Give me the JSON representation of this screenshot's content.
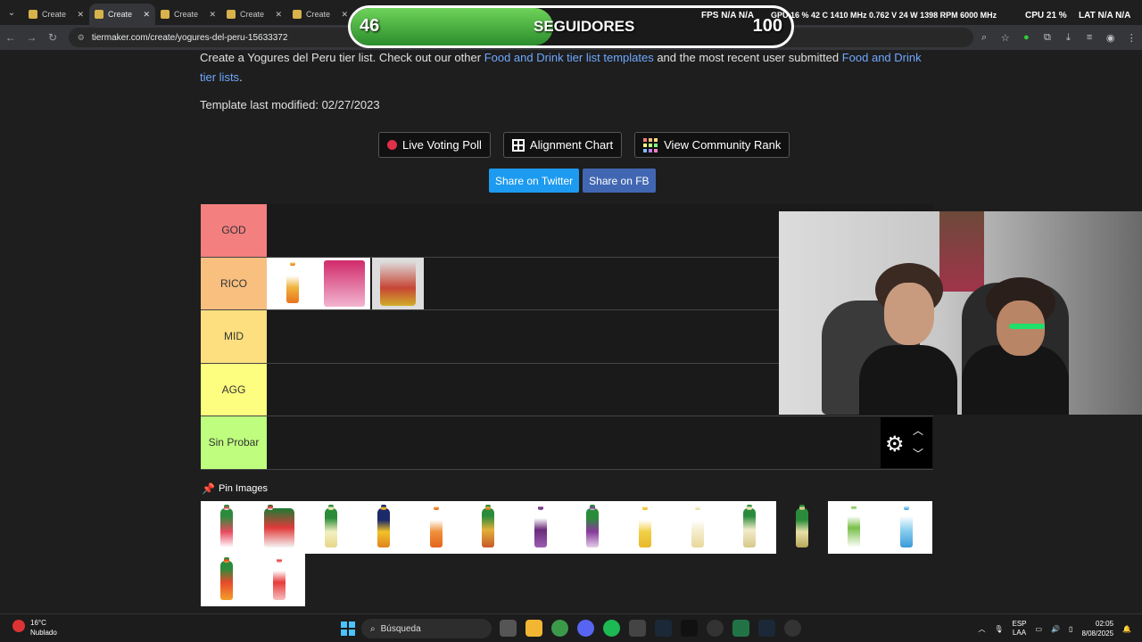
{
  "browser": {
    "tabs": [
      {
        "label": "Create",
        "active": false
      },
      {
        "label": "Create",
        "active": true
      },
      {
        "label": "Create",
        "active": false
      },
      {
        "label": "Create",
        "active": false
      },
      {
        "label": "Create",
        "active": false
      }
    ],
    "url": "tiermaker.com/create/yogures-del-peru-15633372"
  },
  "overlay": {
    "current": "46",
    "label": "SEGUIDORES",
    "goal": "100",
    "progress": 0.46,
    "hud": {
      "fps": "FPS N/A N/A",
      "gpu": "GPU 16 % 42 C 1410 MHz 0.762 V 24 W 1398 RPM 6000 MHz",
      "cpu": "CPU 21 %",
      "lat": "LAT N/A N/A"
    }
  },
  "page": {
    "description_part1": "Create a Yogures del Peru tier list. Check out our other ",
    "link1": "Food and Drink tier list templates",
    "description_part2": " and the most recent user submitted ",
    "link2": "Food and Drink tier lists",
    "description_end": ".",
    "modified": "Template last modified: 02/27/2023",
    "buttons": {
      "poll": "Live Voting Poll",
      "alignment": "Alignment Chart",
      "community": "View Community Rank"
    },
    "share": {
      "twitter": "Share on Twitter",
      "fb": "Share on FB"
    },
    "pin_label": "Pin Images"
  },
  "tiers": [
    {
      "label": "GOD",
      "color": "#f47f7f"
    },
    {
      "label": "RICO",
      "color": "#f8bf7f"
    },
    {
      "label": "MID",
      "color": "#fddf7f"
    },
    {
      "label": "AGG",
      "color": "#fdfd7f"
    },
    {
      "label": "Sin Probar",
      "color": "#bffd7f"
    }
  ],
  "colors": {
    "twitter": "#1d9bf0",
    "fb": "#4267b2"
  },
  "taskbar": {
    "temp": "16°C",
    "condition": "Nublado",
    "search_placeholder": "Búsqueda",
    "lang": "ESP",
    "lang2": "LAA",
    "time": "02:05",
    "date": "8/08/2025"
  }
}
